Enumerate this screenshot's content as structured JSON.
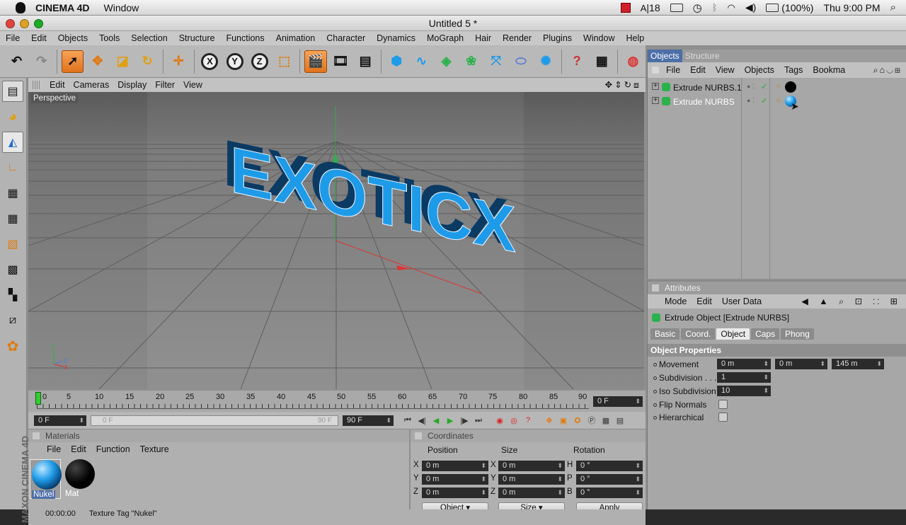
{
  "macos": {
    "app": "CINEMA 4D",
    "menu": [
      "Window"
    ],
    "status": {
      "frame": "18",
      "battery": "(100%)",
      "clock": "Thu 9:00 PM"
    }
  },
  "window": {
    "title": "Untitled 5 *"
  },
  "menus": [
    "File",
    "Edit",
    "Objects",
    "Tools",
    "Selection",
    "Structure",
    "Functions",
    "Animation",
    "Character",
    "Dynamics",
    "MoGraph",
    "Hair",
    "Render",
    "Plugins",
    "Window",
    "Help"
  ],
  "viewport": {
    "menu": [
      "Edit",
      "Cameras",
      "Display",
      "Filter",
      "View"
    ],
    "label": "Perspective",
    "text3d": "EXOTICX",
    "axis": [
      "Y",
      "Z",
      "X"
    ]
  },
  "timeline": {
    "ticks": [
      "0",
      "5",
      "10",
      "15",
      "20",
      "25",
      "30",
      "35",
      "40",
      "45",
      "50",
      "55",
      "60",
      "65",
      "70",
      "75",
      "80",
      "85",
      "90"
    ],
    "frame": "0 F",
    "range_start": "0 F",
    "slider_start": "0 F",
    "slider_end": "90 F",
    "range_end": "90 F"
  },
  "materials": {
    "header": "Materials",
    "menu": [
      "File",
      "Edit",
      "Function",
      "Texture"
    ],
    "items": [
      {
        "name": "Nukel"
      },
      {
        "name": "Mat"
      }
    ]
  },
  "coordinates": {
    "header": "Coordinates",
    "cols": [
      "Position",
      "Size",
      "Rotation"
    ],
    "rows": [
      {
        "a": "X",
        "pos": "0 m",
        "b": "X",
        "size": "0 m",
        "c": "H",
        "rot": "0 °"
      },
      {
        "a": "Y",
        "pos": "0 m",
        "b": "Y",
        "size": "0 m",
        "c": "P",
        "rot": "0 °"
      },
      {
        "a": "Z",
        "pos": "0 m",
        "b": "Z",
        "size": "0 m",
        "c": "B",
        "rot": "0 °"
      }
    ],
    "mode": "Object",
    "sizemode": "Size",
    "apply": "Apply"
  },
  "status_bar": {
    "time": "00:00:00",
    "text": "Texture Tag \"Nukel\""
  },
  "branding": "MAXON CINEMA 4D",
  "object_manager": {
    "tabs": [
      "Objects",
      "Structure"
    ],
    "menu": [
      "File",
      "Edit",
      "View",
      "Objects",
      "Tags",
      "Bookma"
    ],
    "objects": [
      {
        "name": "Extrude NURBS.1"
      },
      {
        "name": "Extrude NURBS"
      }
    ]
  },
  "attributes": {
    "header": "Attributes",
    "menu": [
      "Mode",
      "Edit",
      "User Data"
    ],
    "object_title": "Extrude Object [Extrude NURBS]",
    "tabs": [
      "Basic",
      "Coord.",
      "Object",
      "Caps",
      "Phong"
    ],
    "section": "Object Properties",
    "props": {
      "movement_label": "Movement",
      "movement": [
        "0 m",
        "0 m",
        "145 m"
      ],
      "subdivision_label": "Subdivision",
      "subdivision": "1",
      "iso_label": "Iso Subdivision",
      "iso": "10",
      "flip_label": "Flip Normals",
      "hier_label": "Hierarchical"
    }
  },
  "colors": {
    "accent": "#f08a2e",
    "extrude_blue": "#1e9be8",
    "selection": "#4d6fa8"
  }
}
